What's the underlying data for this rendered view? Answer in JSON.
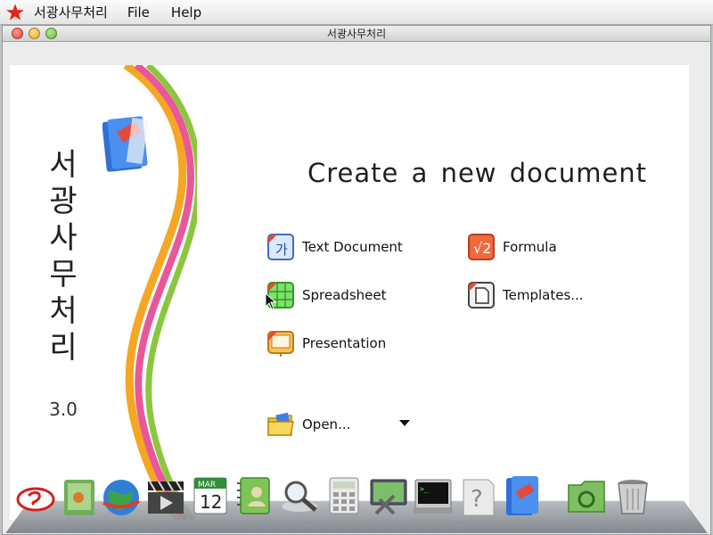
{
  "menubar": {
    "app_name": "서광사무처리",
    "menus": [
      "File",
      "Help"
    ]
  },
  "window": {
    "title": "서광사무처리"
  },
  "sidebar": {
    "title_chars": [
      "서",
      "광",
      "사",
      "무",
      "처",
      "리"
    ],
    "version": "3.0"
  },
  "main": {
    "heading": "Create a new document",
    "items": {
      "text_document": "Text Document",
      "formula": "Formula",
      "spreadsheet": "Spreadsheet",
      "templates": "Templates...",
      "presentation": "Presentation",
      "open": "Open..."
    }
  },
  "dock": {
    "icons": [
      "sogwang-logo-icon",
      "file-manager-icon",
      "globe-browser-icon",
      "video-player-icon",
      "calendar-icon",
      "address-book-icon",
      "search-magnifier-icon",
      "calculator-icon",
      "system-tools-icon",
      "terminal-icon",
      "help-icon",
      "office-suite-icon",
      "recycle-folder-icon",
      "trash-icon"
    ],
    "calendar_month": "MAR",
    "calendar_day": "12"
  },
  "colors": {
    "accent_red": "#e8402c",
    "wave_green": "#8cc63f",
    "wave_pink": "#e9579b",
    "wave_orange": "#f5a623"
  }
}
